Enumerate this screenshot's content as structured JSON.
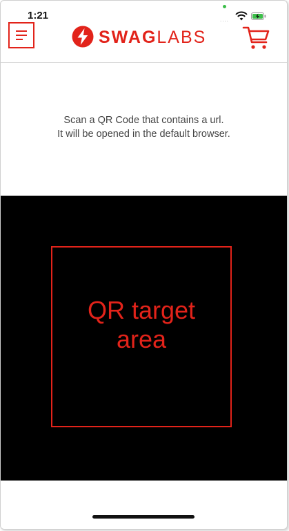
{
  "status_bar": {
    "time": "1:21",
    "signal": "....",
    "wifi_icon": "wifi-icon",
    "battery_icon": "battery-charging-icon"
  },
  "header": {
    "menu_icon": "menu-icon",
    "logo": {
      "bold_part": "SWAG",
      "light_part": "LABS",
      "icon": "lightning-bolt-icon"
    },
    "cart_icon": "cart-icon"
  },
  "instructions": {
    "line1": "Scan a QR Code that contains a url.",
    "line2": "It will be opened in the default browser."
  },
  "scanner": {
    "target_label_line1": "QR target",
    "target_label_line2": "area"
  },
  "colors": {
    "brand_red": "#e2231a",
    "camera_background": "#000000"
  }
}
